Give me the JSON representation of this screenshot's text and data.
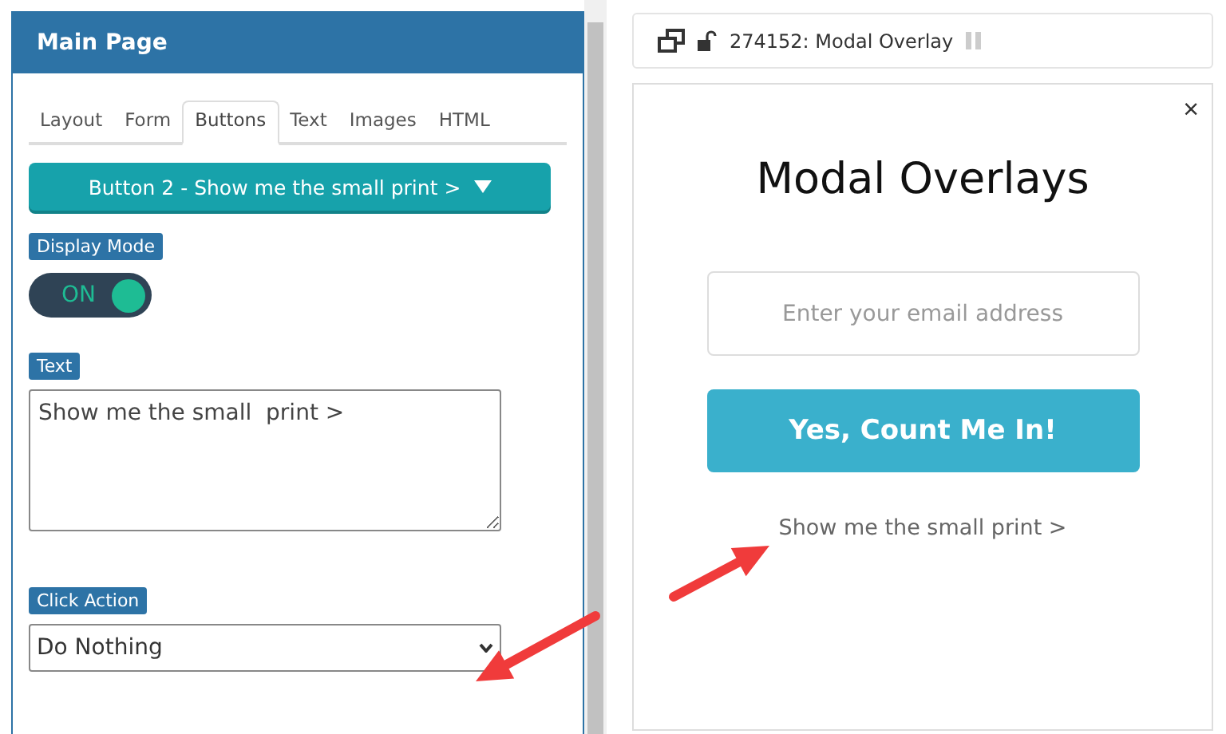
{
  "editor": {
    "title": "Main Page",
    "tabs": [
      {
        "label": "Layout",
        "selected": false
      },
      {
        "label": "Form",
        "selected": false
      },
      {
        "label": "Buttons",
        "selected": true
      },
      {
        "label": "Text",
        "selected": false
      },
      {
        "label": "Images",
        "selected": false
      },
      {
        "label": "HTML",
        "selected": false
      }
    ],
    "button_picker": {
      "label": "Button 2 - Show me the small print >"
    },
    "display_mode": {
      "label": "Display Mode",
      "toggle_label": "ON",
      "on": true
    },
    "text": {
      "label": "Text",
      "value": "Show me the small  print >"
    },
    "click_action": {
      "label": "Click Action",
      "value": "Do Nothing"
    }
  },
  "preview": {
    "title": "274152: Modal Overlay",
    "modal": {
      "heading": "Modal Overlays",
      "close": "×",
      "email": {
        "placeholder": "Enter your email address"
      },
      "submit": "Yes, Count Me In!",
      "link": "Show me the small print >"
    }
  }
}
